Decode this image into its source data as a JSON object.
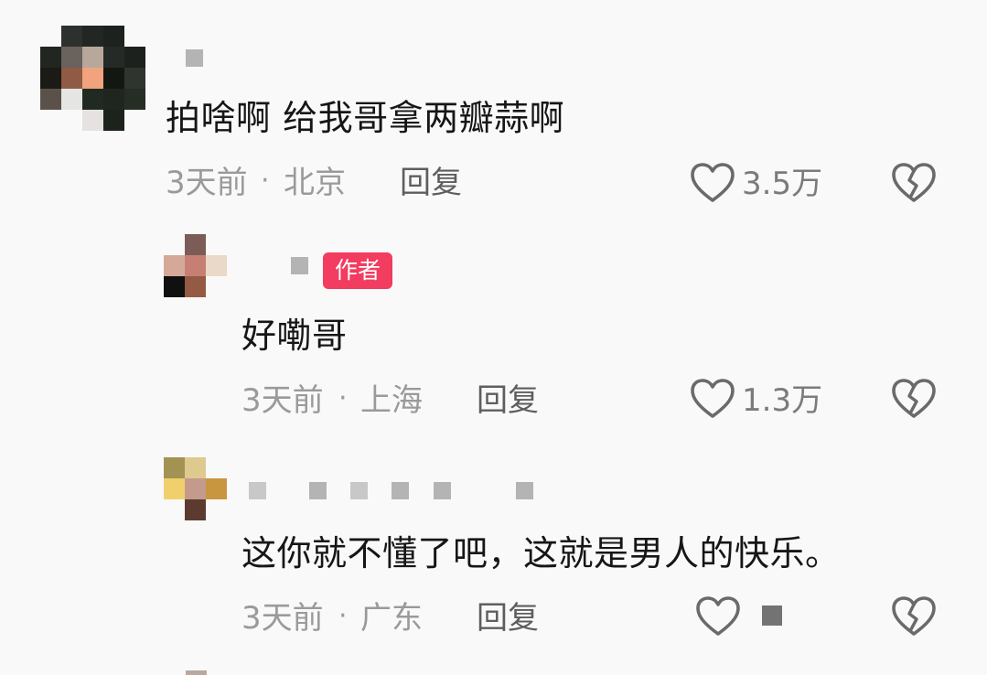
{
  "comments": [
    {
      "text": "拍啥啊 给我哥拿两瓣蒜啊",
      "time": "3天前",
      "sep": "·",
      "location": "北京",
      "reply_label": "回复",
      "likes": "3.5万"
    },
    {
      "author_badge": "作者",
      "text": "好嘞哥",
      "time": "3天前",
      "sep": "·",
      "location": "上海",
      "reply_label": "回复",
      "likes": "1.3万"
    },
    {
      "text": "这你就不懂了吧，这就是男人的快乐。",
      "time": "3天前",
      "sep": "·",
      "location": "广东",
      "reply_label": "回复",
      "likes": ""
    }
  ],
  "colors": {
    "background": "#f9f9f9",
    "author_badge": "#f23c60",
    "text": "#161616",
    "meta": "#9a9a9a",
    "icon": "#6a6a6a"
  },
  "icons": [
    "heart-outline-icon",
    "broken-heart-icon"
  ]
}
